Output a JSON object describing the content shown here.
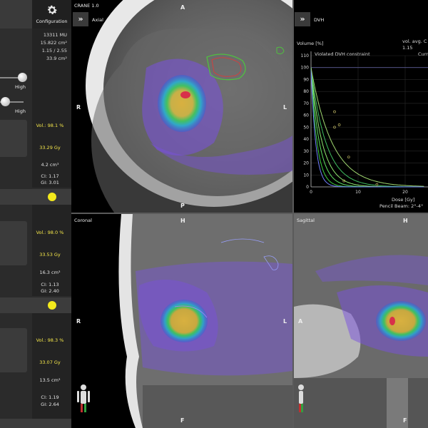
{
  "app": {
    "title": "CRANE 1.0"
  },
  "config": {
    "label": "Configuration"
  },
  "stats": {
    "mu": "13311 MU",
    "area1": "15.822 cm²",
    "ratio": "1.15 / 2.55",
    "area2": "33.9 cm²"
  },
  "sliders": [
    {
      "label": "High",
      "value": 0.9
    },
    {
      "label": "High",
      "value": 0.05
    }
  ],
  "targets": [
    {
      "vol": "Vol.: 98.1 %",
      "dose": "33.29 Gy",
      "size": "4.2 cm³",
      "ci": "CI:  1.17",
      "gi": "GI:  3.01"
    },
    {
      "vol": "Vol.: 98.0 %",
      "dose": "33.53 Gy",
      "size": "16.3 cm³",
      "ci": "CI:  1.13",
      "gi": "GI:  2.40"
    },
    {
      "vol": "Vol.: 98.3 %",
      "dose": "33.07 Gy",
      "size": "13.5 cm³",
      "ci": "CI:  1.19",
      "gi": "GI:  2.64"
    }
  ],
  "views": {
    "axial": {
      "title": "Axial",
      "top": "A",
      "bottom": "P",
      "left": "R",
      "right": "L"
    },
    "coronal": {
      "title": "Coronal",
      "top": "H",
      "bottom": "F",
      "left": "R",
      "right": "L"
    },
    "sagittal": {
      "title": "Sagittal",
      "top": "H",
      "bottom": "F",
      "left": "A",
      "right": ""
    }
  },
  "dvh": {
    "title": "DVH",
    "ylabel": "Volume [%]",
    "violated": "Violated DVH constraint",
    "vol_avg": "vol. avg. C",
    "vol_avg_val": "1.15",
    "curr": "Curr",
    "xlabel": "Dose [Gy]",
    "pencil": "Pencil Beam: 2°-4°",
    "yticks": [
      "110",
      "100",
      "90",
      "80",
      "70",
      "60",
      "50",
      "40",
      "30",
      "20",
      "10",
      "0"
    ],
    "xticks": [
      "0",
      "10",
      "20"
    ]
  },
  "colors": {
    "accent_yellow": "#f4ea1c",
    "panel_bg": "#2b2b2b"
  }
}
